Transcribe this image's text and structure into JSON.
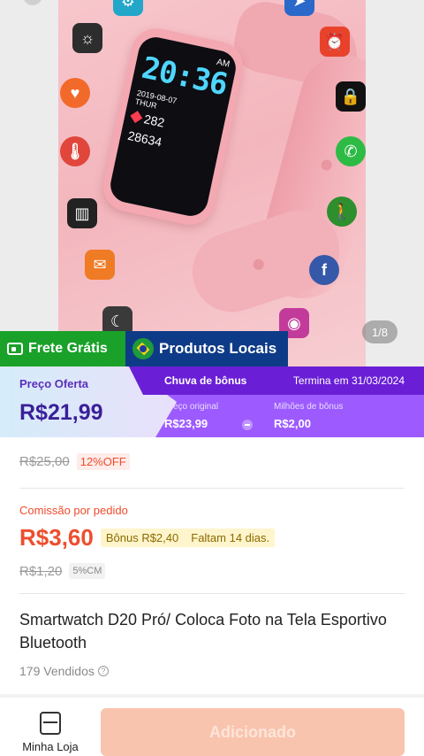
{
  "gallery": {
    "page_indicator": "1/8",
    "watch_screen": {
      "am": "AM",
      "time": "20:36",
      "date": "2019-08-07",
      "day": "THUR",
      "bpm": "282",
      "steps": "28634"
    }
  },
  "badges": {
    "frete": "Frete Grátis",
    "local": "Produtos Locais"
  },
  "offer": {
    "label": "Preço Oferta",
    "price": "R$21,99",
    "bonus_title": "Chuva de bônus",
    "ends": "Termina em 31/03/2024",
    "original_label": "Preço original",
    "original_value": "R$23,99",
    "bonus_label": "Milhões de bônus",
    "bonus_value": "R$2,00"
  },
  "pricing": {
    "old_price": "R$25,00",
    "discount": "12%OFF",
    "commission_label": "Comissão por pedido",
    "commission_value": "R$3,60",
    "bonus_text": "Bônus R$2,40",
    "days_left": "Faltam 14 dias.",
    "cm_old": "R$1,20",
    "cm_badge": "5%CM"
  },
  "product": {
    "title": "Smartwatch D20 Pró/ Coloca Foto na Tela Esportivo Bluetooth",
    "sold": "179 Vendidos",
    "help": "?"
  },
  "bottom_bar": {
    "shop_label": "Minha Loja",
    "add_label": "Adicionado"
  },
  "colors": {
    "accent": "#ee4d2d",
    "frete_green": "#1aa12a",
    "local_blue": "#0e3b87",
    "offer_purple": "#6a1fd6",
    "add_button_disabled": "#f9c4ad"
  }
}
